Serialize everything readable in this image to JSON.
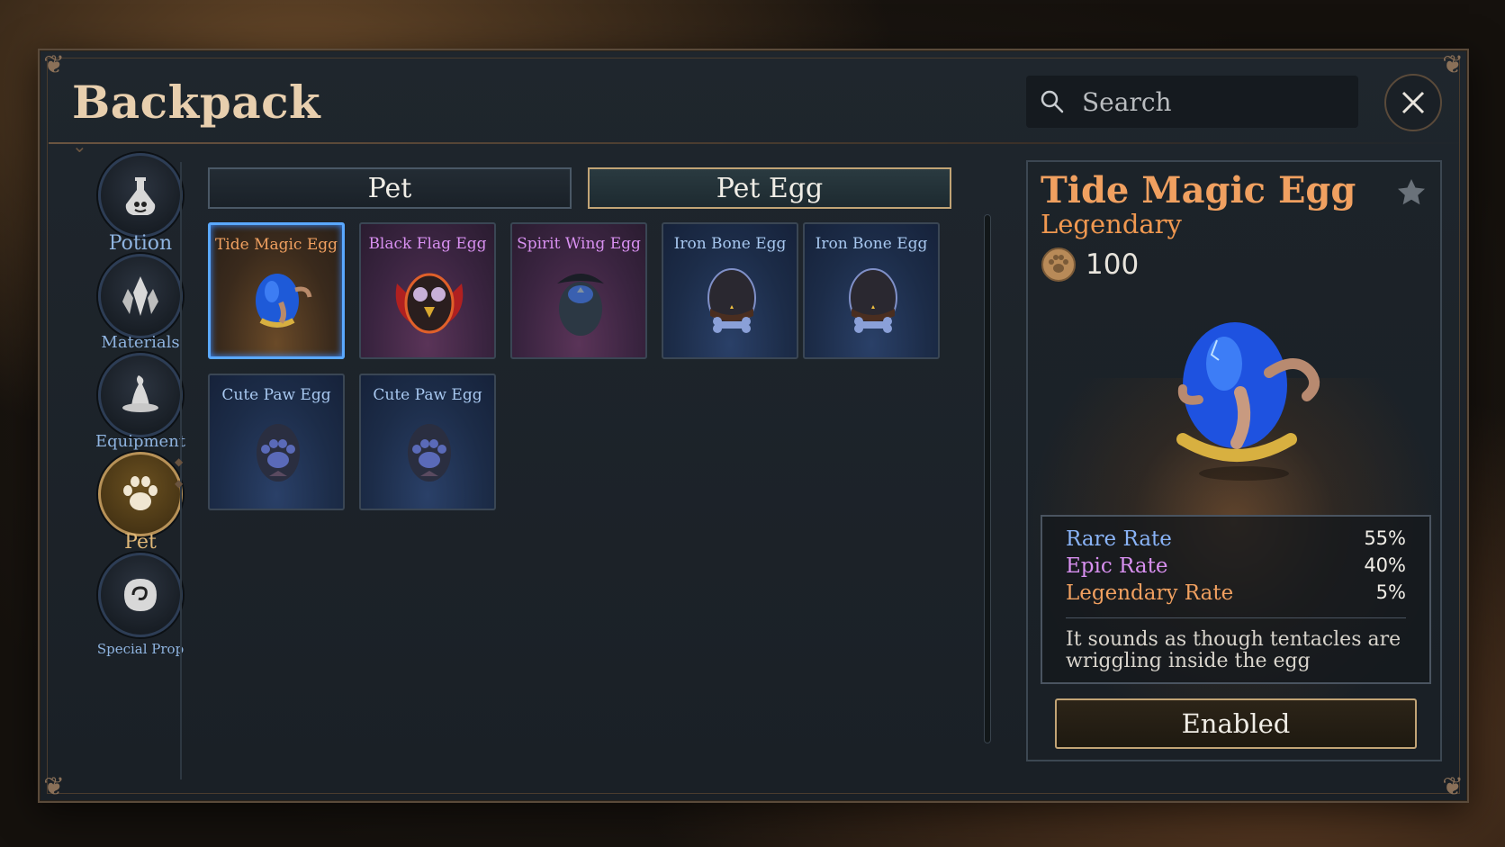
{
  "window": {
    "title": "Backpack"
  },
  "search": {
    "placeholder": "Search"
  },
  "sidebar": {
    "items": [
      {
        "label": "Potion",
        "icon": "potion-flask-icon"
      },
      {
        "label": "Materials",
        "icon": "crystal-icon"
      },
      {
        "label": "Equipment",
        "icon": "wizard-hat-icon"
      },
      {
        "label": "Pet",
        "icon": "paw-icon",
        "active": true
      },
      {
        "label": "Special Prop",
        "icon": "special-prop-icon"
      }
    ]
  },
  "tabs": [
    {
      "label": "Pet",
      "active": false
    },
    {
      "label": "Pet Egg",
      "active": true
    }
  ],
  "grid": {
    "items": [
      {
        "name": "Tide Magic Egg",
        "rarity": "legendary",
        "selected": true
      },
      {
        "name": "Black Flag Egg",
        "rarity": "epic"
      },
      {
        "name": "Spirit Wing Egg",
        "rarity": "epic"
      },
      {
        "name": "Iron Bone Egg",
        "rarity": "rare"
      },
      {
        "name": "Iron Bone Egg",
        "rarity": "rare"
      },
      {
        "name": "Cute Paw Egg",
        "rarity": "rare"
      },
      {
        "name": "Cute Paw Egg",
        "rarity": "rare"
      }
    ]
  },
  "detail": {
    "name": "Tide Magic Egg",
    "rarity": "Legendary",
    "price": "100",
    "rates": [
      {
        "label": "Rare Rate",
        "value": "55%"
      },
      {
        "label": "Epic Rate",
        "value": "40%"
      },
      {
        "label": "Legendary Rate",
        "value": "5%"
      }
    ],
    "description": "It sounds as though tentacles are wriggling inside the egg",
    "button_label": "Enabled"
  },
  "colors": {
    "legendary": "#f0a060",
    "epic": "#d890f0",
    "rare": "#8ab4f8",
    "gold_border": "#c2a476",
    "selected_border": "#5aa8ff"
  }
}
